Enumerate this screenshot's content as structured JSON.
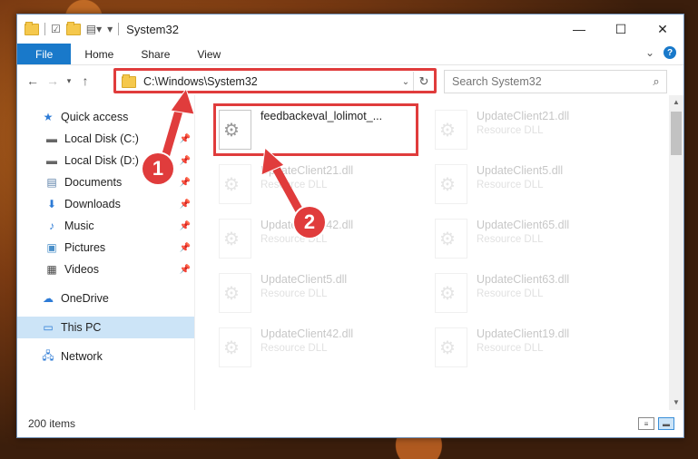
{
  "window": {
    "title": "System32",
    "controls": {
      "minimize": "—",
      "maximize": "☐",
      "close": "✕"
    }
  },
  "ribbon": {
    "tabs": [
      "File",
      "Home",
      "Share",
      "View"
    ],
    "expand_glyph": "⌄",
    "help_glyph": "?"
  },
  "navigation": {
    "address": "C:\\Windows\\System32",
    "search_placeholder": "Search System32"
  },
  "sidebar": {
    "items": [
      {
        "label": "Quick access",
        "icon": "star-icon"
      },
      {
        "label": "Local Disk (C:)",
        "icon": "drive-icon",
        "pinned": true
      },
      {
        "label": "Local Disk (D:)",
        "icon": "drive-icon",
        "pinned": true
      },
      {
        "label": "Documents",
        "icon": "documents-icon",
        "pinned": true
      },
      {
        "label": "Downloads",
        "icon": "download-icon",
        "pinned": true
      },
      {
        "label": "Music",
        "icon": "music-icon",
        "pinned": true
      },
      {
        "label": "Pictures",
        "icon": "pictures-icon",
        "pinned": true
      },
      {
        "label": "Videos",
        "icon": "video-icon",
        "pinned": true
      },
      {
        "label": "OneDrive",
        "icon": "cloud-icon"
      },
      {
        "label": "This PC",
        "icon": "computer-icon",
        "selected": true
      },
      {
        "label": "Network",
        "icon": "network-icon"
      }
    ]
  },
  "files": [
    {
      "name": "feedbackeval_lolimot_...",
      "type": ""
    },
    {
      "name": "UpdateClient21.dll",
      "type": "Resource DLL"
    },
    {
      "name": "UpdateClient21.dll",
      "type": "Resource DLL"
    },
    {
      "name": "UpdateClient5.dll",
      "type": "Resource DLL"
    },
    {
      "name": "UpdateClient42.dll",
      "type": "Resource DLL"
    },
    {
      "name": "UpdateClient65.dll",
      "type": "Resource DLL"
    },
    {
      "name": "UpdateClient5.dll",
      "type": "Resource DLL"
    },
    {
      "name": "UpdateClient63.dll",
      "type": "Resource DLL"
    },
    {
      "name": "UpdateClient42.dll",
      "type": "Resource DLL"
    },
    {
      "name": "UpdateClient19.dll",
      "type": "Resource DLL"
    }
  ],
  "status": {
    "item_count": "200 items"
  },
  "annotations": {
    "badge1": "1",
    "badge2": "2",
    "color": "#e03c3c"
  }
}
